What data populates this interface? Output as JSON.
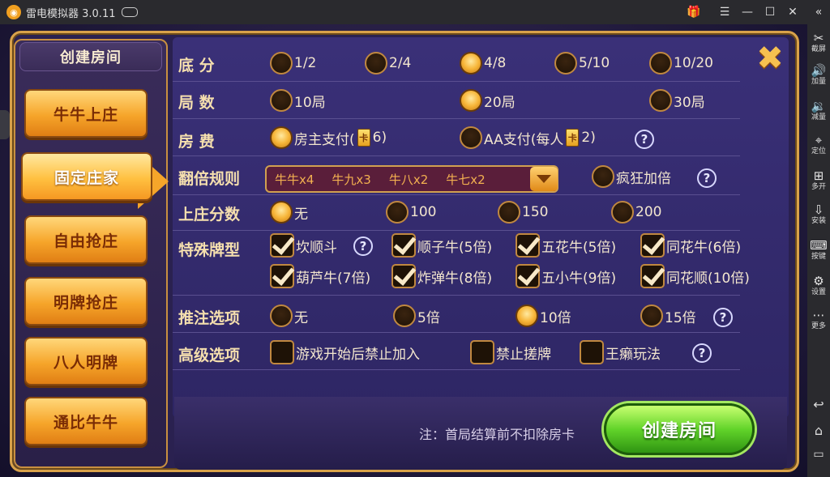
{
  "emulator": {
    "title": "雷电模拟器 3.0.11",
    "sidebar": [
      {
        "label": "截屏",
        "icon": "scissors-icon",
        "glyph": "✂"
      },
      {
        "label": "加量",
        "icon": "volume-up-icon",
        "glyph": "🔊"
      },
      {
        "label": "减量",
        "icon": "volume-down-icon",
        "glyph": "🔉"
      },
      {
        "label": "定位",
        "icon": "location-icon",
        "glyph": "⌖"
      },
      {
        "label": "多开",
        "icon": "multi-instance-icon",
        "glyph": "⊞"
      },
      {
        "label": "安装",
        "icon": "apk-install-icon",
        "glyph": "⇩"
      },
      {
        "label": "按键",
        "icon": "keyboard-icon",
        "glyph": "⌨"
      },
      {
        "label": "设置",
        "icon": "settings-icon",
        "glyph": "⚙"
      },
      {
        "label": "更多",
        "icon": "more-icon",
        "glyph": "⋯"
      }
    ]
  },
  "left_menu": {
    "title": "创建房间",
    "items": [
      "牛牛上庄",
      "固定庄家",
      "自由抢庄",
      "明牌抢庄",
      "八人明牌",
      "通比牛牛"
    ],
    "active_index": 1
  },
  "options": {
    "base_score": {
      "label": "底    分",
      "choices": [
        "1/2",
        "2/4",
        "4/8",
        "5/10",
        "10/20"
      ],
      "selected": 2
    },
    "rounds": {
      "label": "局    数",
      "choices": [
        "10局",
        "20局",
        "30局"
      ],
      "selected": 1
    },
    "room_fee": {
      "label": "房    费",
      "owner_pay": "房主支付(",
      "owner_amount": "6)",
      "aa_pay": "AA支付(每人",
      "aa_amount": "2)",
      "selected": 0
    },
    "multiplier_rule": {
      "label": "翻倍规则",
      "values": [
        "牛牛x4",
        "牛九x3",
        "牛八x2",
        "牛七x2"
      ],
      "crazy": "疯狂加倍",
      "crazy_checked": false
    },
    "banker_score": {
      "label": "上庄分数",
      "choices": [
        "无",
        "100",
        "150",
        "200"
      ],
      "selected": 0
    },
    "special_cards": {
      "label": "特殊牌型",
      "items": [
        "坎顺斗",
        "顺子牛(5倍)",
        "五花牛(5倍)",
        "同花牛(6倍)",
        "葫芦牛(7倍)",
        "炸弹牛(8倍)",
        "五小牛(9倍)",
        "同花顺(10倍)"
      ],
      "checked": [
        true,
        true,
        true,
        true,
        true,
        true,
        true,
        true
      ]
    },
    "push_bet": {
      "label": "推注选项",
      "choices": [
        "无",
        "5倍",
        "10倍",
        "15倍"
      ],
      "selected": 2
    },
    "advanced": {
      "label": "高级选项",
      "items": [
        "游戏开始后禁止加入",
        "禁止搓牌",
        "王癞玩法"
      ],
      "checked": [
        false,
        false,
        false
      ]
    }
  },
  "footer": {
    "note": "注：首局结算前不扣除房卡",
    "create_button": "创建房间"
  },
  "help_glyph": "?",
  "close_glyph": "✖",
  "card_glyph": "卡"
}
